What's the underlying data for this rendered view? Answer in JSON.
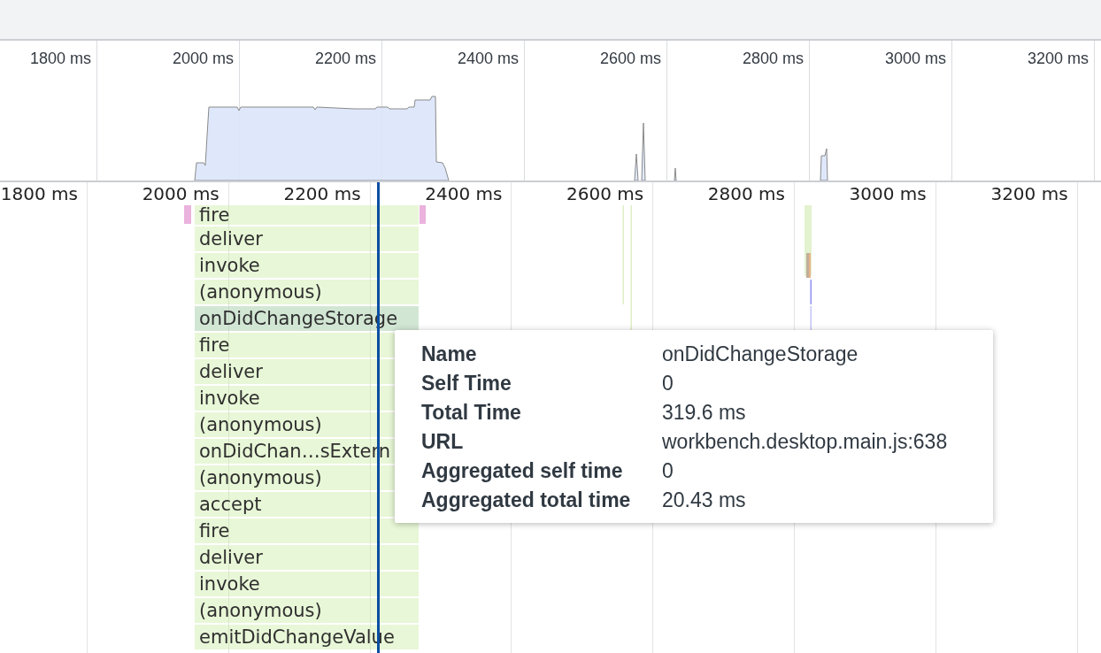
{
  "overview": {
    "ticks": [
      "1800 ms",
      "2000 ms",
      "2200 ms",
      "2400 ms",
      "2600 ms",
      "2800 ms",
      "3000 ms",
      "3200 ms"
    ]
  },
  "flame_chart": {
    "ticks": [
      "1800 ms",
      "2000 ms",
      "2200 ms",
      "2400 ms",
      "2600 ms",
      "2800 ms",
      "3000 ms",
      "3200 ms"
    ],
    "entries": [
      {
        "label": "fire",
        "selected": false
      },
      {
        "label": "deliver",
        "selected": false
      },
      {
        "label": "invoke",
        "selected": false
      },
      {
        "label": "(anonymous)",
        "selected": false
      },
      {
        "label": "onDidChangeStorage",
        "selected": true
      },
      {
        "label": "fire",
        "selected": false
      },
      {
        "label": "deliver",
        "selected": false
      },
      {
        "label": "invoke",
        "selected": false
      },
      {
        "label": "(anonymous)",
        "selected": false
      },
      {
        "label": "onDidChan…sExtern",
        "selected": false
      },
      {
        "label": "(anonymous)",
        "selected": false
      },
      {
        "label": "accept",
        "selected": false
      },
      {
        "label": "fire",
        "selected": false
      },
      {
        "label": "deliver",
        "selected": false
      },
      {
        "label": "invoke",
        "selected": false
      },
      {
        "label": "(anonymous)",
        "selected": false
      },
      {
        "label": "emitDidChangeValue",
        "selected": false
      }
    ]
  },
  "tooltip": {
    "rows": [
      {
        "label": "Name",
        "value": "onDidChangeStorage"
      },
      {
        "label": "Self Time",
        "value": "0"
      },
      {
        "label": "Total Time",
        "value": "319.6 ms"
      },
      {
        "label": "URL",
        "value": "workbench.desktop.main.js:638"
      },
      {
        "label": "Aggregated self time",
        "value": "0"
      },
      {
        "label": "Aggregated total time",
        "value": "20.43 ms"
      }
    ]
  }
}
